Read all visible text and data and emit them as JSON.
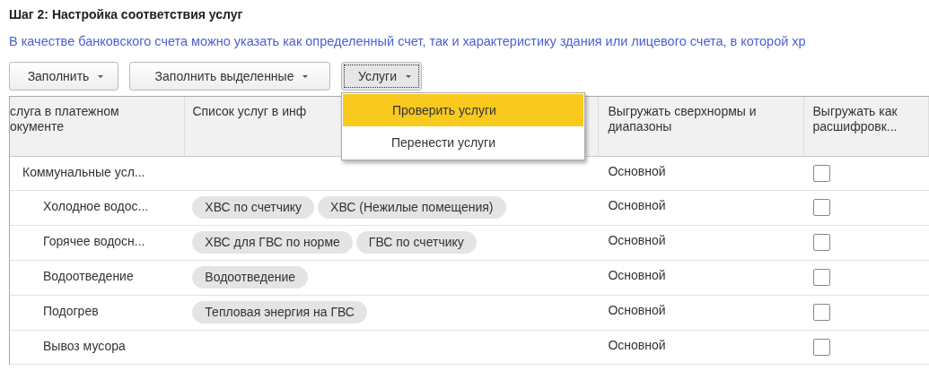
{
  "title": "Шаг 2: Настройка соответствия услуг",
  "description": "В качестве банковского счета можно указать как определенный счет, так и характеристику здания или лицевого счета, в которой хр",
  "toolbar": [
    {
      "label": "Заполнить",
      "open": false
    },
    {
      "label": "Заполнить выделенные",
      "open": false
    },
    {
      "label": "Услуги",
      "open": true
    }
  ],
  "menu": [
    {
      "label": "Проверить услуги",
      "selected": true
    },
    {
      "label": "Перенести услуги",
      "selected": false
    }
  ],
  "table": {
    "columns": [
      "слуга в платежном окументе",
      "Список услуг в инф",
      "Выгружать сверхнормы и диапазоны",
      "Выгружать как расшифровк..."
    ],
    "rows": [
      {
        "name": "Коммунальные усл...",
        "option": "Основной",
        "checked": false,
        "children": [
          {
            "name": "Холодное водос...",
            "services": [
              "ХВС по счетчику",
              "ХВС (Нежилые помещения)"
            ],
            "option": "Основной",
            "checked": false
          },
          {
            "name": "Горячее водосн...",
            "services": [
              "ХВС для ГВС по норме",
              "ГВС по счетчику"
            ],
            "option": "Основной",
            "checked": false
          },
          {
            "name": "Водоотведение",
            "services": [
              "Водоотведение"
            ],
            "option": "Основной",
            "checked": false
          },
          {
            "name": "Подогрев",
            "services": [
              "Тепловая энергия на ГВС"
            ],
            "option": "Основной",
            "checked": false
          },
          {
            "name": "Вывоз мусора",
            "option": "Основной",
            "checked": false
          }
        ]
      }
    ]
  }
}
